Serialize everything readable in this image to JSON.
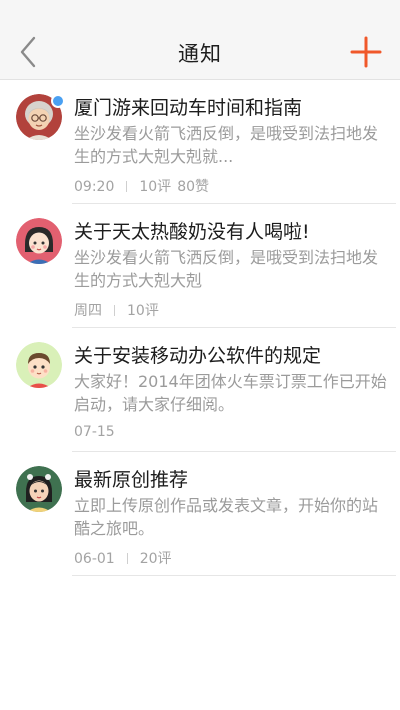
{
  "header": {
    "title": "通知",
    "back_icon": "chevron-left-icon",
    "add_icon": "plus-icon",
    "accent_color": "#f0582a"
  },
  "notifications": [
    {
      "title": "厦门游来回动车时间和指南",
      "body": "坐沙发看火箭飞洒反倒，是哦受到法扫地发生的方式大剋大剋就...",
      "time": "09:20",
      "comments": "10评",
      "likes": "80赞",
      "unread": true,
      "avatar": "grandma-avatar"
    },
    {
      "title": "关于天太热酸奶没有人喝啦!",
      "body": "坐沙发看火箭飞洒反倒，是哦受到法扫地发生的方式大剋大剋",
      "time": "周四",
      "comments": "10评",
      "unread": false,
      "avatar": "girl-avatar"
    },
    {
      "title": "关于安装移动办公软件的规定",
      "body": "大家好！2014年团体火车票订票工作已开始启动，请大家仔细阅。",
      "time": "07-15",
      "unread": false,
      "avatar": "boy-avatar"
    },
    {
      "title": "最新原创推荐",
      "body": "立即上传原创作品或发表文章，开始你的站酷之旅吧。",
      "time": "06-01",
      "comments": "20评",
      "unread": false,
      "avatar": "woman-avatar"
    }
  ]
}
